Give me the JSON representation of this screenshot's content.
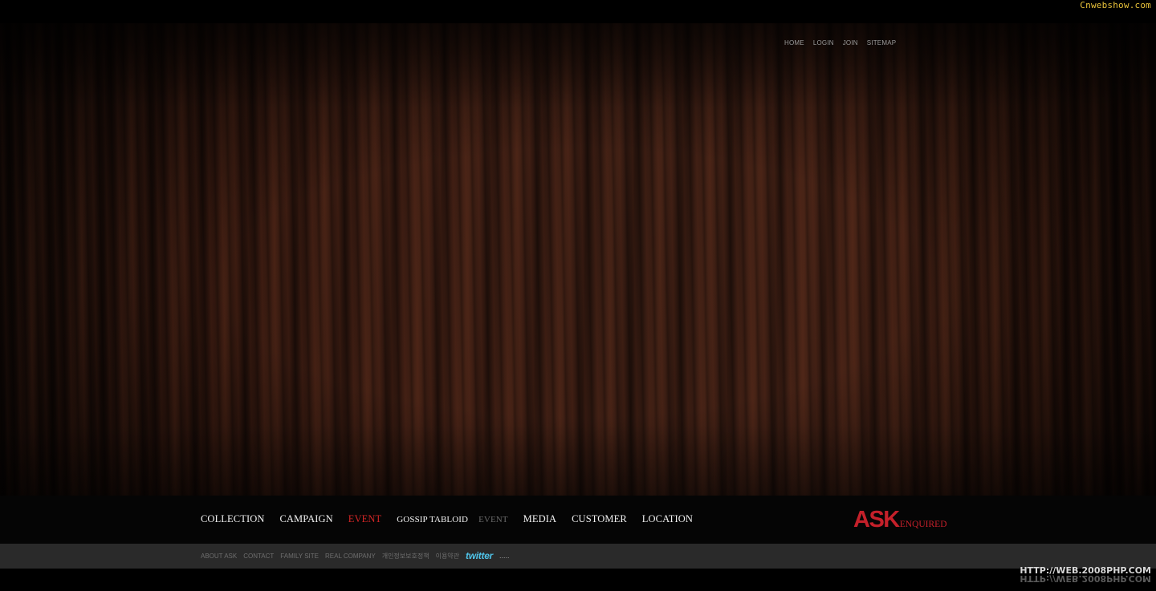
{
  "watermark_top": "Cnwebshow.com",
  "utility_nav": [
    "HOME",
    "LOGIN",
    "JOIN",
    "SITEMAP"
  ],
  "main_nav": {
    "items": [
      {
        "label": "COLLECTION"
      },
      {
        "label": "CAMPAIGN"
      },
      {
        "label": "EVENT",
        "active": true
      },
      {
        "label": "GOSSIP TABLOID"
      },
      {
        "label": "EVENT",
        "muted": true
      },
      {
        "label": "MEDIA"
      },
      {
        "label": "CUSTOMER"
      },
      {
        "label": "LOCATION"
      }
    ]
  },
  "logo": {
    "mark": "ASK",
    "sub": "ENQUIRED",
    "color": "#c4202a"
  },
  "footer": {
    "links": [
      "ABOUT ASK",
      "CONTACT",
      "FAMILY SITE",
      "REAL COMPANY",
      "개인정보보호정책",
      "이용약관"
    ],
    "twitter": "twitter",
    "more": "....."
  },
  "watermark_bottom": "HTTP://WEB.2008PHP.COM",
  "colors": {
    "accent": "#d32626",
    "twitter": "#4fc3e8"
  }
}
